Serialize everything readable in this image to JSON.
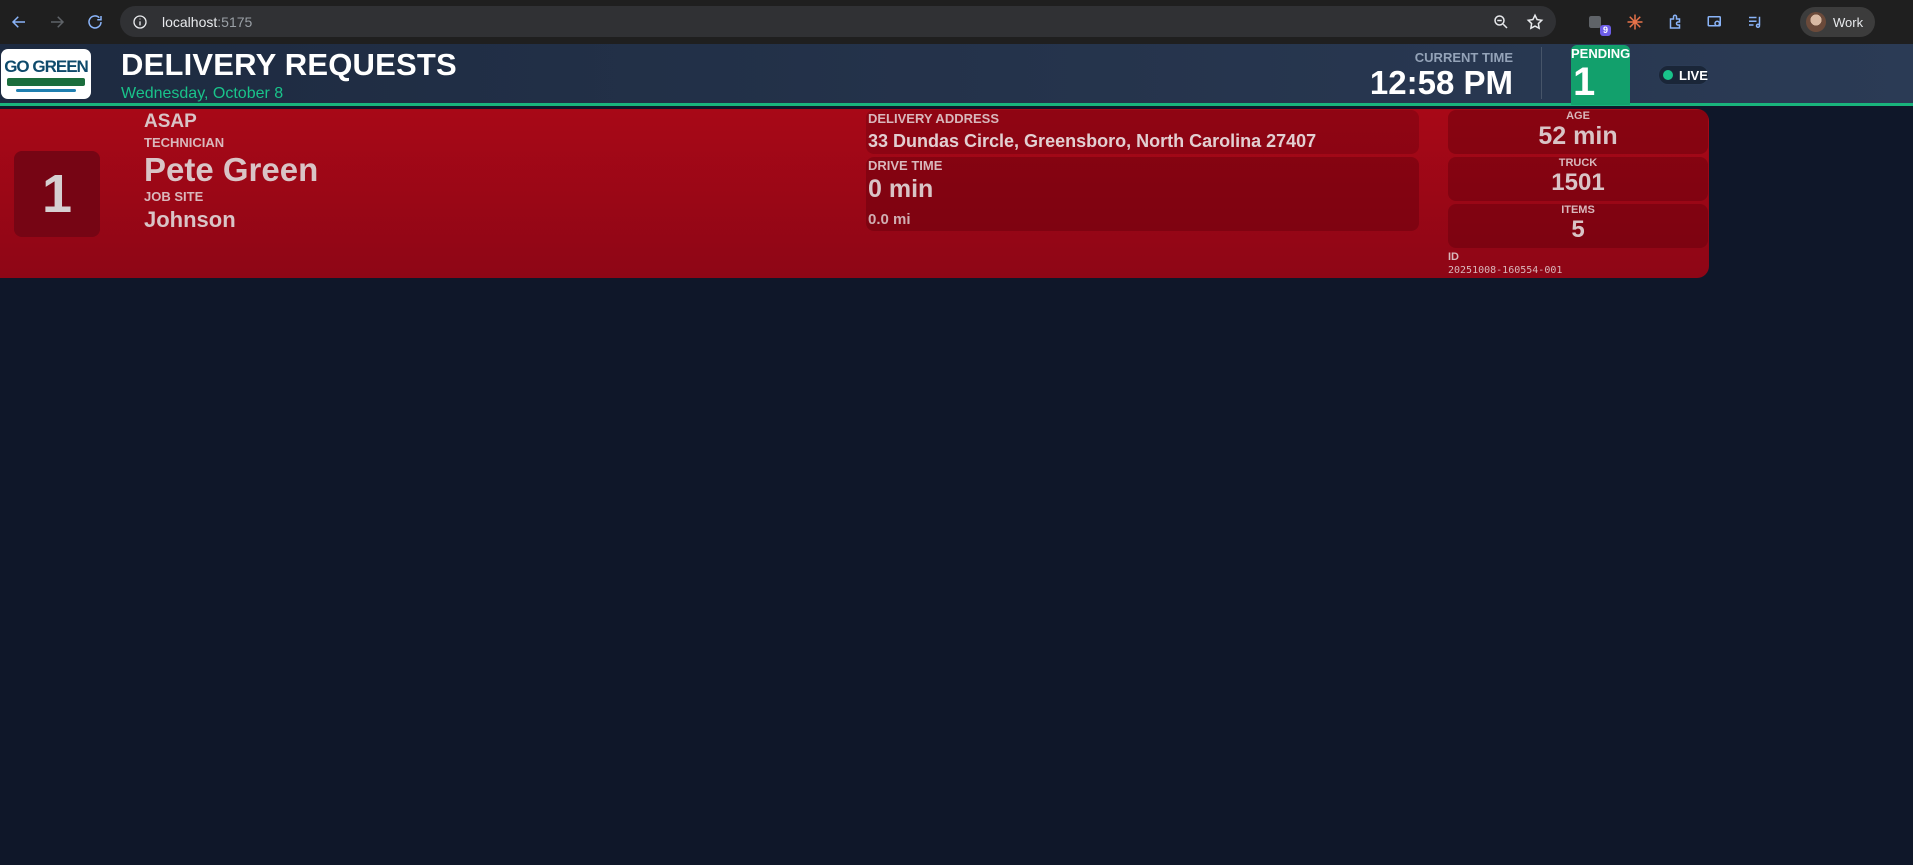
{
  "browser": {
    "url_host": "localhost",
    "url_port": ":5175",
    "extension_badge": "9",
    "profile_label": "Work"
  },
  "header": {
    "logo_text": "GO GREEN",
    "title": "DELIVERY REQUESTS",
    "date": "Wednesday, October 8",
    "current_time_label": "CURRENT TIME",
    "current_time": "12:58 PM",
    "pending_label": "PENDING",
    "pending_count": "1",
    "live_label": "LIVE"
  },
  "requests": [
    {
      "queue_number": "1",
      "priority": "ASAP",
      "technician_label": "TECHNICIAN",
      "technician": "Pete Green",
      "job_site_label": "JOB SITE",
      "job_site": "Johnson",
      "address_label": "DELIVERY ADDRESS",
      "address": "33 Dundas Circle, Greensboro, North Carolina 27407",
      "drive_time_label": "DRIVE TIME",
      "drive_time": "0 min",
      "distance": "0.0 mi",
      "age_label": "AGE",
      "age": "52 min",
      "truck_label": "TRUCK",
      "truck": "1501",
      "items_label": "ITEMS",
      "items": "5",
      "id_label": "ID",
      "id": "20251008-160554-001"
    }
  ],
  "colors": {
    "background": "#0f1729",
    "accent": "#19b47c",
    "card": "#a80817",
    "pending": "#12a06c"
  }
}
